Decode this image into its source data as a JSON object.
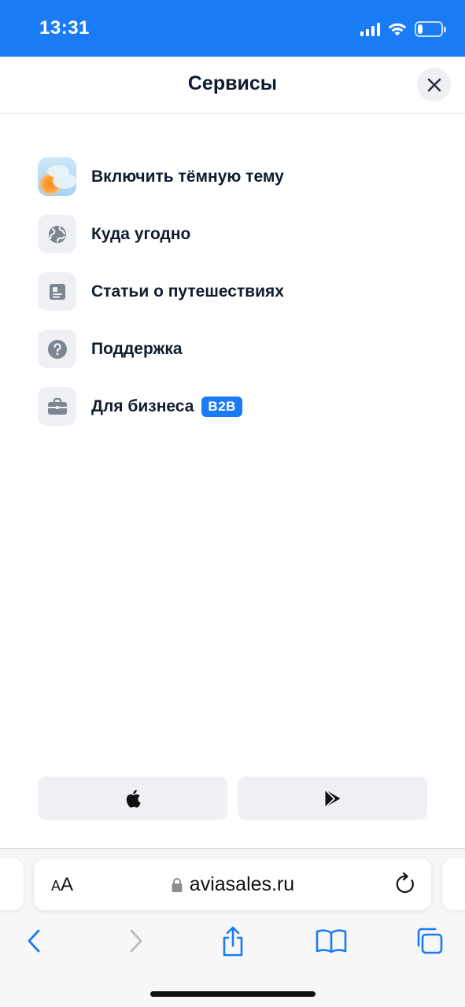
{
  "status_bar": {
    "time": "13:31",
    "icons": [
      "cellular-signal-icon",
      "wifi-icon",
      "battery-icon"
    ],
    "battery_level": 0.2,
    "background_color": "#1a7cf5"
  },
  "header": {
    "title": "Сервисы",
    "close_icon": "close-icon"
  },
  "menu": {
    "items": [
      {
        "label": "Включить тёмную тему",
        "icon": "sun-cloud-icon"
      },
      {
        "label": "Куда угодно",
        "icon": "globe-icon"
      },
      {
        "label": "Статьи о путешествиях",
        "icon": "article-icon"
      },
      {
        "label": "Поддержка",
        "icon": "question-icon"
      },
      {
        "label": "Для бизнеса",
        "icon": "briefcase-icon",
        "badge": "B2B"
      }
    ]
  },
  "stores": {
    "apple_icon": "apple-icon",
    "google_play_icon": "google-play-icon"
  },
  "safari": {
    "text_size_label": "AA",
    "url": "aviasales.ru",
    "toolbar_icons": [
      "back-icon",
      "forward-icon",
      "share-icon",
      "bookmarks-icon",
      "tabs-icon"
    ]
  },
  "colors": {
    "accent": "#1a7cf5",
    "text": "#0f1c2e",
    "icon_bg": "#eef0f3",
    "icon_gray": "#7d8590"
  }
}
